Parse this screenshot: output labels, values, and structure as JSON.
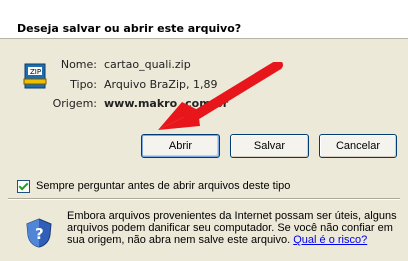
{
  "dialog": {
    "title": "Deseja salvar ou abrir este arquivo?",
    "fields": {
      "name_label": "Nome:",
      "name_value": "cartao_quali.zip",
      "type_label": "Tipo:",
      "type_value": "Arquivo BraZip, 1,89",
      "origin_label": "Origem:",
      "origin_value": "www.makro         .com.br"
    },
    "buttons": {
      "open": "Abrir",
      "save": "Salvar",
      "cancel": "Cancelar"
    },
    "checkbox": {
      "label": "Sempre perguntar antes de abrir arquivos deste tipo",
      "checked": true
    },
    "warning": {
      "text": "Embora arquivos provenientes da Internet possam ser úteis, alguns arquivos podem danificar seu computador. Se você não confiar em sua origem, não abra nem salve este arquivo.",
      "link": "Qual é o risco?"
    }
  },
  "icons": {
    "file": "zip-file-icon",
    "warning": "security-shield-icon",
    "overlay": "red-arrow-annotation"
  },
  "colors": {
    "arrow": "#e8151b",
    "dialog_bg": "#ece9d8",
    "link": "#0000ee"
  }
}
